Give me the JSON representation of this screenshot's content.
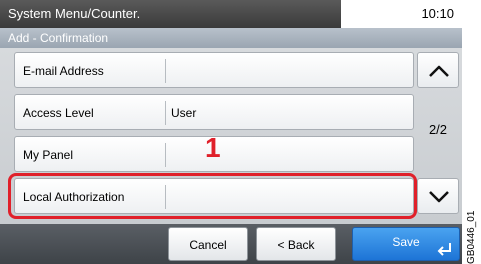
{
  "header": {
    "title": "System Menu/Counter.",
    "time": "10:10"
  },
  "subtitle": "Add - Confirmation",
  "rows": [
    {
      "label": "E-mail Address",
      "value": ""
    },
    {
      "label": "Access Level",
      "value": "User"
    },
    {
      "label": "My Panel",
      "value": ""
    },
    {
      "label": "Local Authorization",
      "value": ""
    }
  ],
  "pager": {
    "indicator": "2/2",
    "up_icon": "chevron-up-icon",
    "down_icon": "chevron-down-icon"
  },
  "callout": "1",
  "footer": {
    "cancel_label": "Cancel",
    "back_label": "< Back",
    "save_label": "Save",
    "enter_icon": "enter-icon"
  },
  "side_code": "GB0446_01",
  "colors": {
    "highlight": "#e0202a",
    "primary_button": "#1d74d6"
  }
}
